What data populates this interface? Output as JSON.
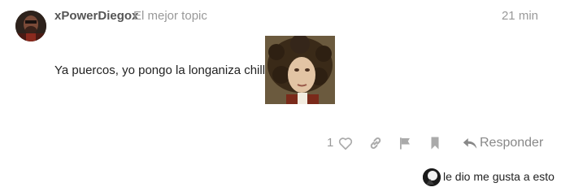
{
  "post": {
    "username": "xPowerDiegox",
    "topic_title": "El mejor topic",
    "time": "21 min",
    "text": "Ya puercos, yo pongo la longaniza chillaneja"
  },
  "actions": {
    "like_count": "1",
    "reply_label": "Responder"
  },
  "liked_by": {
    "text": "le dio me gusta a esto"
  },
  "icons": {
    "like": "heart-outline-icon",
    "link": "link-icon",
    "flag": "flag-icon",
    "bookmark": "bookmark-icon",
    "reply": "reply-arrow-icon"
  },
  "colors": {
    "username": "#555555",
    "muted": "#999999",
    "icon": "#aaaaaa",
    "text": "#222222"
  }
}
